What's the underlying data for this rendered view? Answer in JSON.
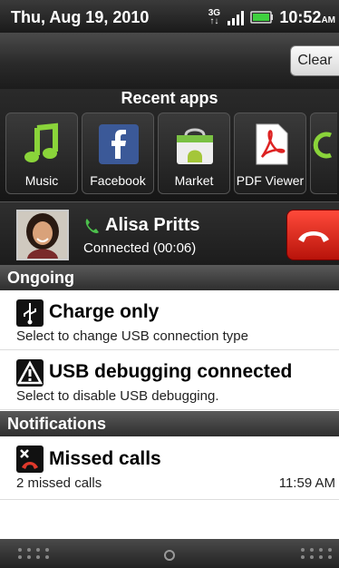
{
  "status_bar": {
    "date": "Thu, Aug 19, 2010",
    "network_top": "3G",
    "network_bottom": "↑↓",
    "time": "10:52",
    "ampm": "AM"
  },
  "header": {
    "clear_label": "Clear"
  },
  "recent_apps": {
    "title": "Recent apps",
    "apps": [
      {
        "label": "Music",
        "icon": "music-note-icon"
      },
      {
        "label": "Facebook",
        "icon": "facebook-icon"
      },
      {
        "label": "Market",
        "icon": "market-bag-icon"
      },
      {
        "label": "PDF Viewer",
        "icon": "pdf-icon"
      }
    ]
  },
  "call": {
    "name": "Alisa Pritts",
    "status": "Connected (00:06)"
  },
  "ongoing": {
    "title": "Ongoing",
    "items": [
      {
        "title": "Charge only",
        "desc": "Select to change USB connection type",
        "icon": "usb-icon"
      },
      {
        "title": "USB debugging connected",
        "desc": "Select to disable USB debugging.",
        "icon": "warning-icon"
      }
    ]
  },
  "notifications": {
    "title": "Notifications",
    "items": [
      {
        "title": "Missed calls",
        "desc": "2 missed calls",
        "time": "11:59 AM",
        "icon": "missed-call-icon"
      }
    ]
  },
  "colors": {
    "end_call": "#d9261a",
    "call_green": "#4cc04c"
  }
}
